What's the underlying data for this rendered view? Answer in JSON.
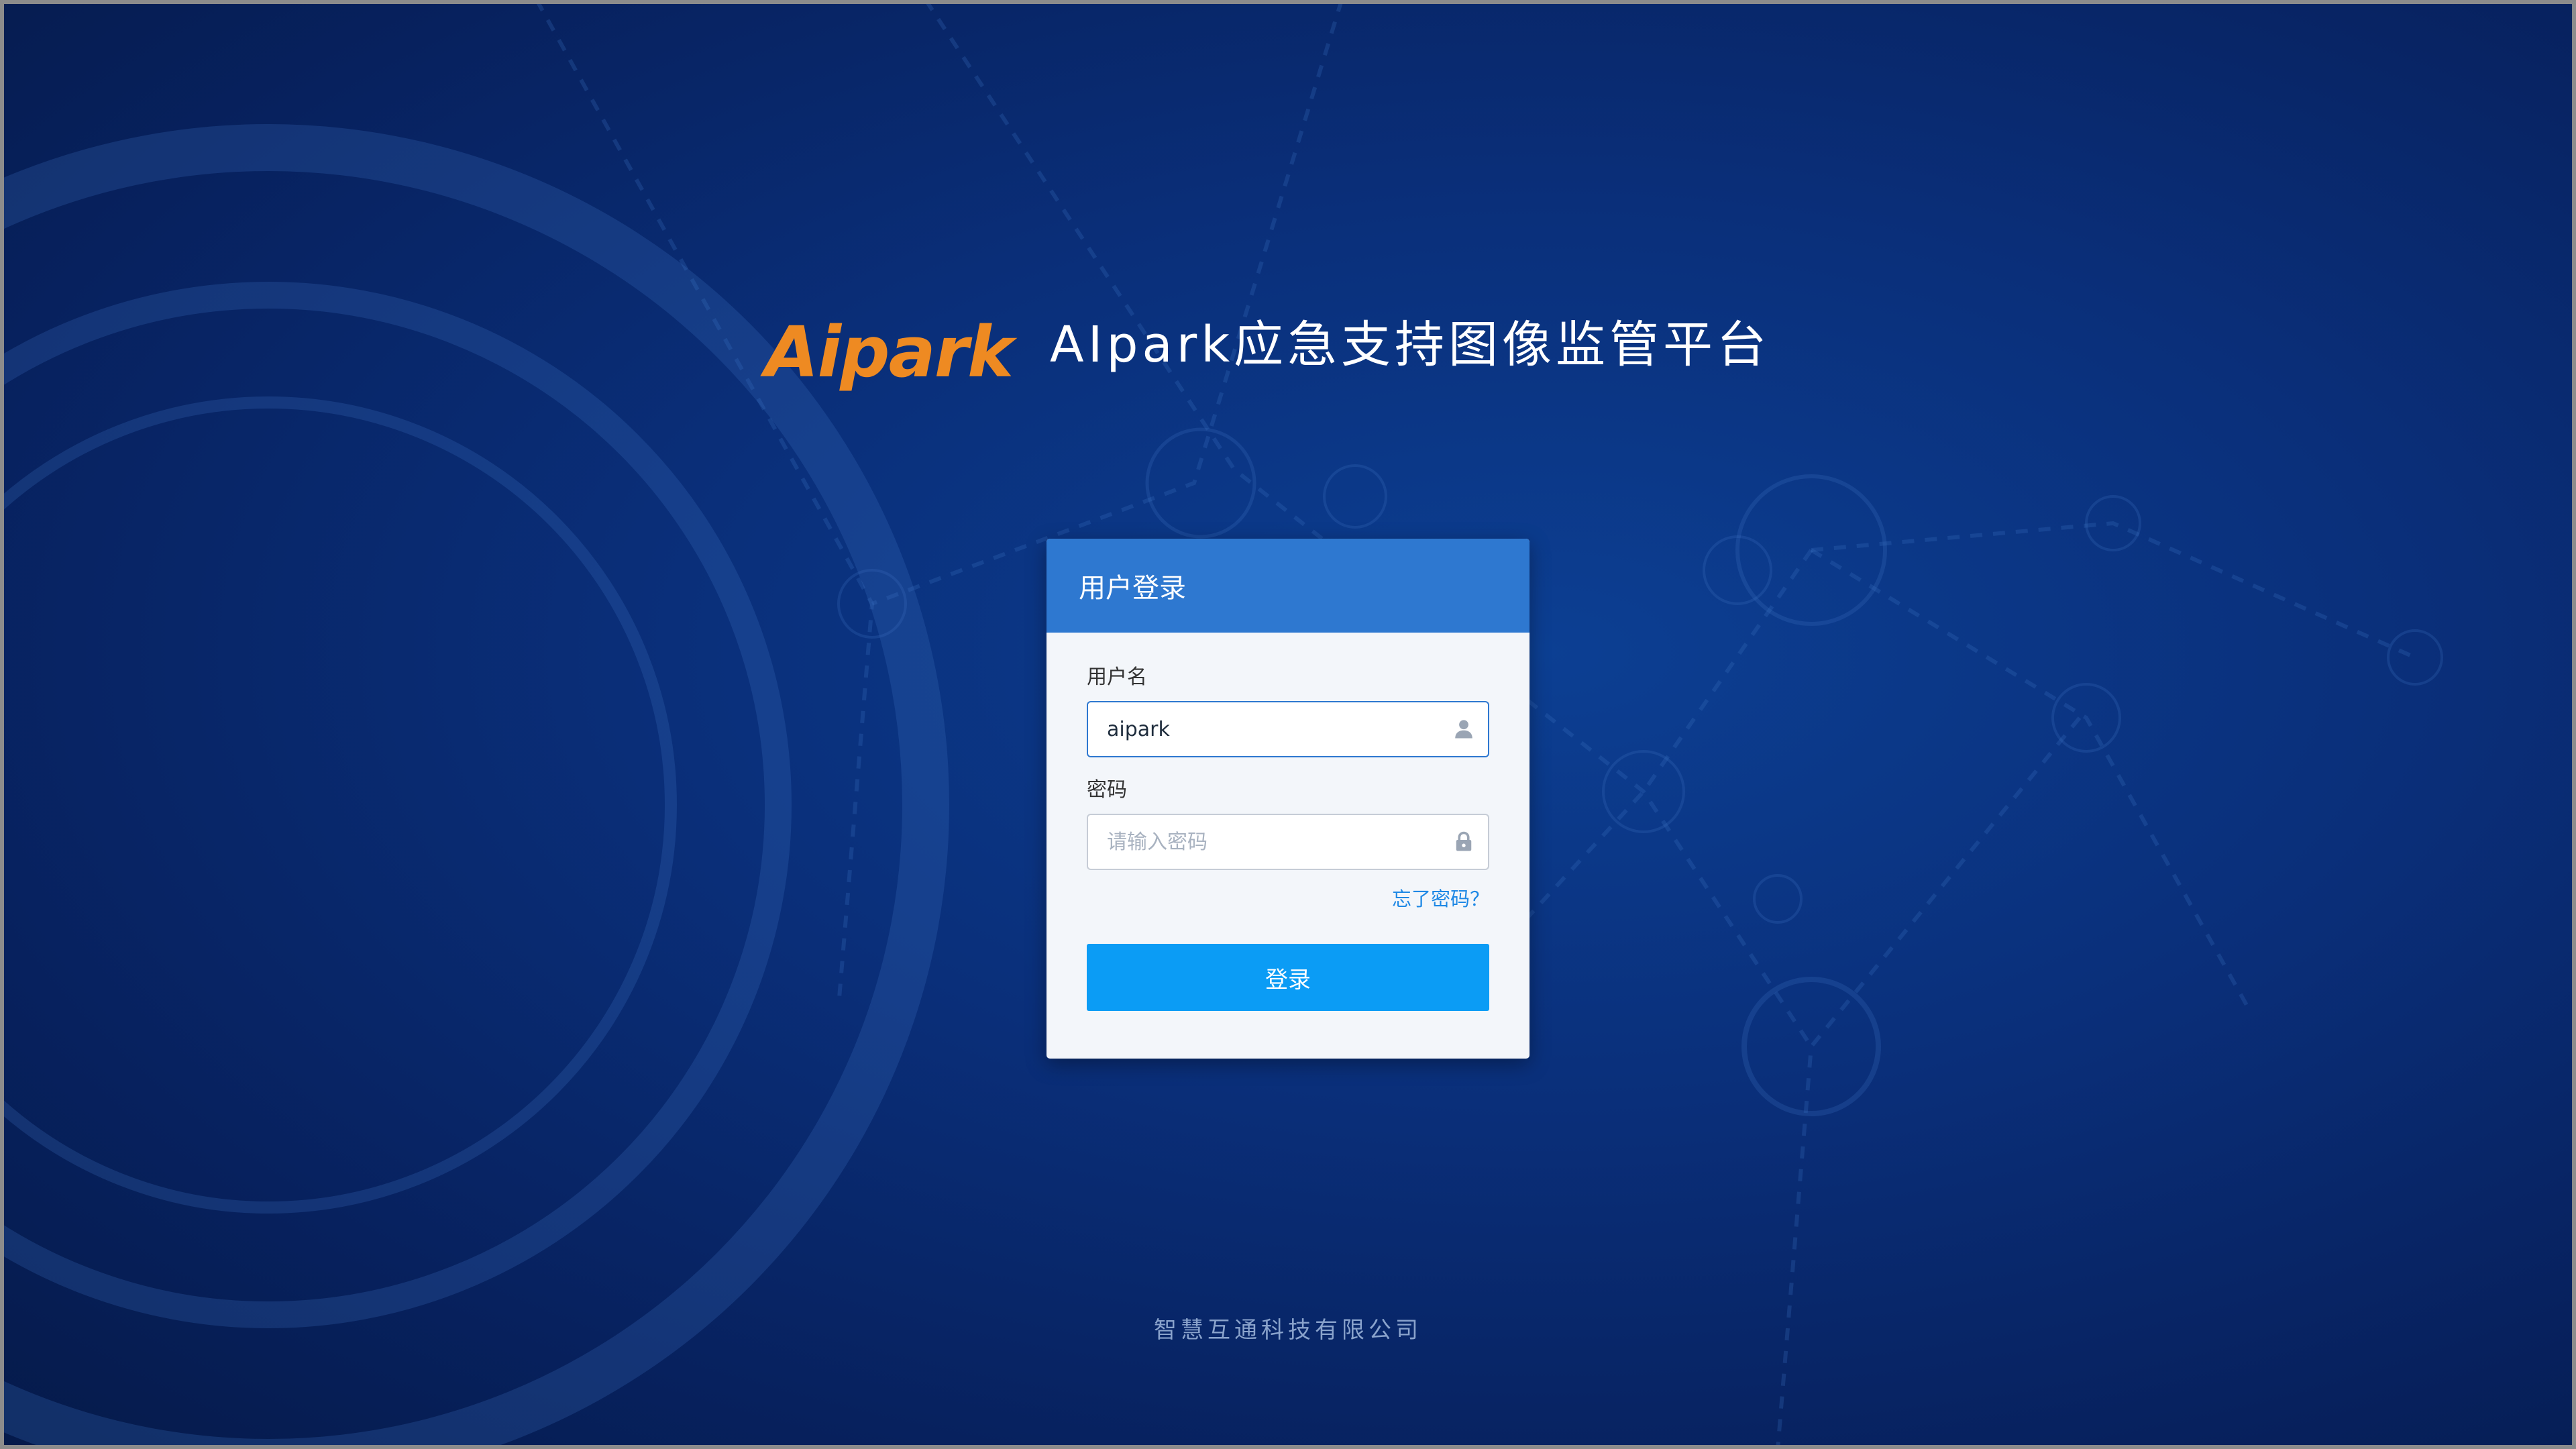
{
  "header": {
    "logo_text": "Aipark",
    "title": "AIpark应急支持图像监管平台"
  },
  "login": {
    "card_title": "用户登录",
    "username_label": "用户名",
    "username_value": "aipark",
    "password_label": "密码",
    "password_placeholder": "请输入密码",
    "forgot_link": "忘了密码？",
    "submit_label": "登录"
  },
  "icons": {
    "username": "user-icon",
    "password": "lock-icon"
  },
  "footer": {
    "company": "智慧互通科技有限公司"
  },
  "colors": {
    "background": "#0a2f7a",
    "brand_orange": "#ee8a22",
    "card_header": "#2e78d0",
    "button": "#0b9cf5",
    "link": "#1e88e5"
  }
}
